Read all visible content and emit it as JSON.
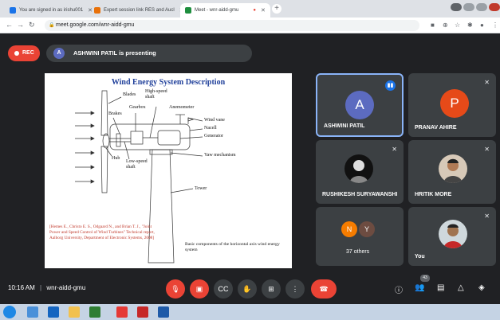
{
  "browser": {
    "tabs": [
      {
        "label": "You are signed in as irishu001",
        "color": "#1a73e8"
      },
      {
        "label": "Expert session link RES and Aucl",
        "color": "#e8710a"
      },
      {
        "label": "Meet - wnr-aidd-gmu",
        "color": "#1e8e3e",
        "active": true
      }
    ],
    "new_tab": "+",
    "url": "meet.google.com/wnr-aidd-gmu"
  },
  "meeting": {
    "rec_label": "REC",
    "presenter_initial": "A",
    "presenting_text": "ASHWINI PATIL is presenting",
    "time": "10:16 AM",
    "divider": "|",
    "code": "wnr-aidd-gmu",
    "participant_count": "43"
  },
  "slide": {
    "title": "Wind Energy System Description",
    "labels": {
      "blades": "Blades",
      "high_speed_shaft": "High-speed shaft",
      "anemometer": "Anemometer",
      "gearbox": "Gearbox",
      "brakes": "Brakes",
      "wind_vane": "Wind vane",
      "nacelle": "Nacell",
      "generator": "Generator",
      "yaw": "Yaw mechanism",
      "hub": "Hub",
      "low_speed_shaft": "Low-speed shaft",
      "tower": "Tower"
    },
    "citation": "[Hemes E., Christo E. S., Odgaard N., and Brian T. J., \"Joint Power and Speed Control of Wind Turbines\" Technical report, Aalborg University, Department of Electronic Systems, 2008]",
    "caption": "Basic components of the horizontal axis wind energy system"
  },
  "participants": [
    {
      "name": "ASHWINI PATIL",
      "initial": "A",
      "color": "#5c6bc0",
      "speaking": true
    },
    {
      "name": "PRANAV AHIRE",
      "initial": "P",
      "color": "#e64a19"
    },
    {
      "name": "RUSHIKESH SURYAWANSHI",
      "photo": true
    },
    {
      "name": "HRITIK MORE",
      "photo": true
    },
    {
      "name": "37 others",
      "minis": [
        {
          "initial": "N",
          "color": "#f57c00"
        },
        {
          "initial": "Y",
          "color": "#6d4c41"
        }
      ]
    },
    {
      "name": "You",
      "photo": true
    }
  ],
  "icons": {
    "mic": "mic-off-icon",
    "cam": "camera-off-icon",
    "captions": "captions-icon",
    "hand": "raise-hand-icon",
    "present": "present-icon",
    "more": "more-icon",
    "hangup": "hangup-icon",
    "info": "info-icon",
    "people": "people-icon",
    "chat": "chat-icon",
    "activities": "activities-icon",
    "host": "host-controls-icon"
  }
}
